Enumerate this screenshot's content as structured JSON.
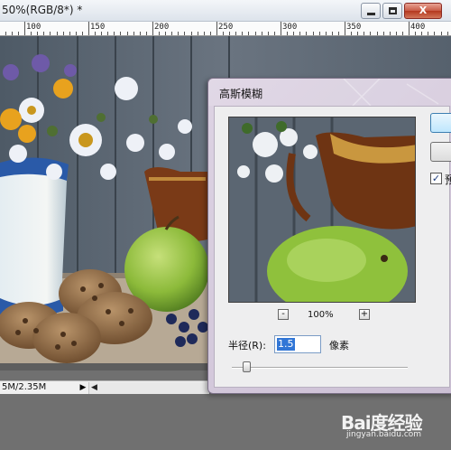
{
  "document": {
    "title": "50%(RGB/8*) *",
    "window_buttons": {
      "minimize": "minimize",
      "maximize": "maximize",
      "close": "X"
    },
    "ruler_marks": [
      "100",
      "150",
      "200",
      "250",
      "300",
      "350",
      "400"
    ],
    "status": {
      "doc_size": "5M/2.35M",
      "menu_arrow": "▶",
      "scroll_left_arrow": "◀"
    }
  },
  "dialog": {
    "title": "高斯模糊",
    "zoom_out": "-",
    "zoom_in": "+",
    "zoom_level": "100%",
    "radius_label": "半径(R):",
    "radius_value": "1.5",
    "radius_unit": "像素",
    "preview_checkbox_checked": true,
    "preview_checkbox_mark": "✓",
    "preview_label": "预",
    "ok_label": "",
    "cancel_label": ""
  },
  "watermark": {
    "brand": "Bai度经验",
    "url": "jingyan.baidu.com"
  },
  "colors": {
    "dialog_bg": "#d8cfe0",
    "radius_selection": "#3176d6",
    "close_button": "#c85a45"
  },
  "icons": [
    "minimize-icon",
    "maximize-icon",
    "close-icon",
    "zoom-out-icon",
    "zoom-in-icon",
    "checkbox-check-icon",
    "menu-arrow-icon",
    "scroll-left-icon"
  ]
}
